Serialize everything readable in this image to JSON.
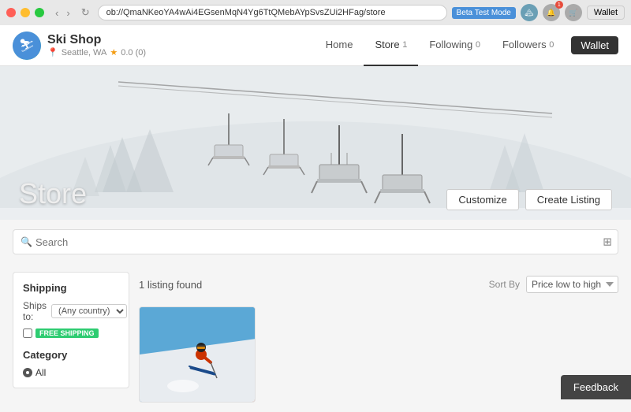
{
  "titlebar": {
    "url": "ob://QmaNKeoYA4wAi4EGsenMqN4Yg6TtQMebAYpSvsZUi2HFag/store",
    "beta_label": "Beta Test Mode"
  },
  "navbar": {
    "shop_name": "Ski Shop",
    "shop_location": "Seattle, WA",
    "shop_rating": "0.0 (0)",
    "nav_home": "Home",
    "nav_store": "Store",
    "nav_store_count": "1",
    "nav_following": "Following",
    "nav_following_count": "0",
    "nav_followers": "Followers",
    "nav_followers_count": "0",
    "nav_wallet": "Wallet"
  },
  "hero": {
    "store_title": "Store",
    "customize_label": "Customize",
    "create_listing_label": "Create Listing"
  },
  "search": {
    "placeholder": "Search"
  },
  "sidebar": {
    "shipping_title": "Shipping",
    "ships_to_label": "Ships to:",
    "ships_to_value": "(Any country)",
    "free_shipping_label": "FREE SHIPPING",
    "category_title": "Category",
    "category_all": "All"
  },
  "listings": {
    "count_text": "1 listing found",
    "sort_label": "Sort By",
    "sort_value": "Price low to high"
  },
  "feedback": {
    "label": "Feedback"
  }
}
